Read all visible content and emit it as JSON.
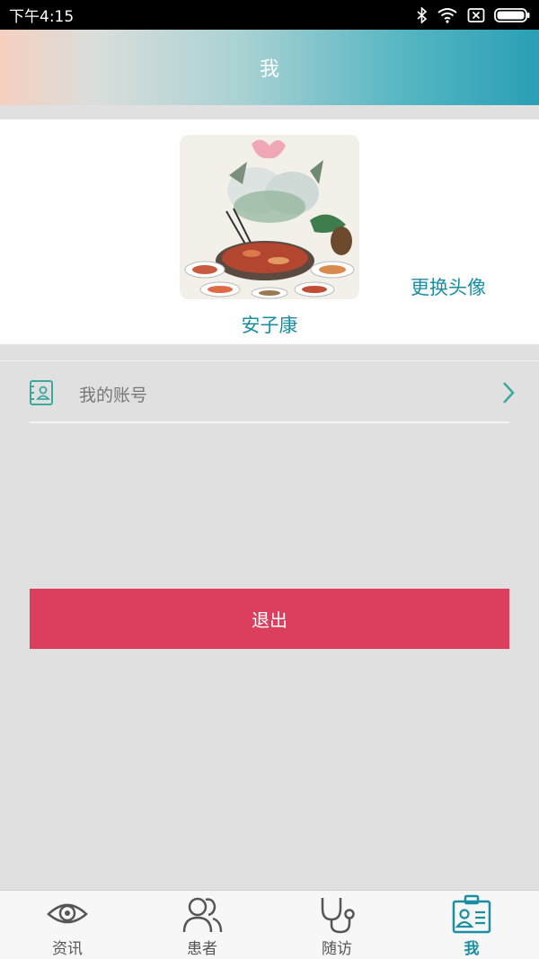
{
  "status_bar": {
    "time": "下午4:15"
  },
  "header": {
    "title": "我"
  },
  "profile": {
    "username": "安子康",
    "change_avatar_label": "更换头像"
  },
  "menu": {
    "account_label": "我的账号"
  },
  "logout_label": "退出",
  "tabs": [
    {
      "label": "资讯",
      "icon": "eye-icon",
      "active": false
    },
    {
      "label": "患者",
      "icon": "patients-icon",
      "active": false
    },
    {
      "label": "随访",
      "icon": "stethoscope-icon",
      "active": false
    },
    {
      "label": "我",
      "icon": "id-badge-icon",
      "active": true
    }
  ],
  "colors": {
    "accent": "#1a8ea3",
    "logout": "#dc3f5e",
    "background": "#e0e0e0"
  }
}
